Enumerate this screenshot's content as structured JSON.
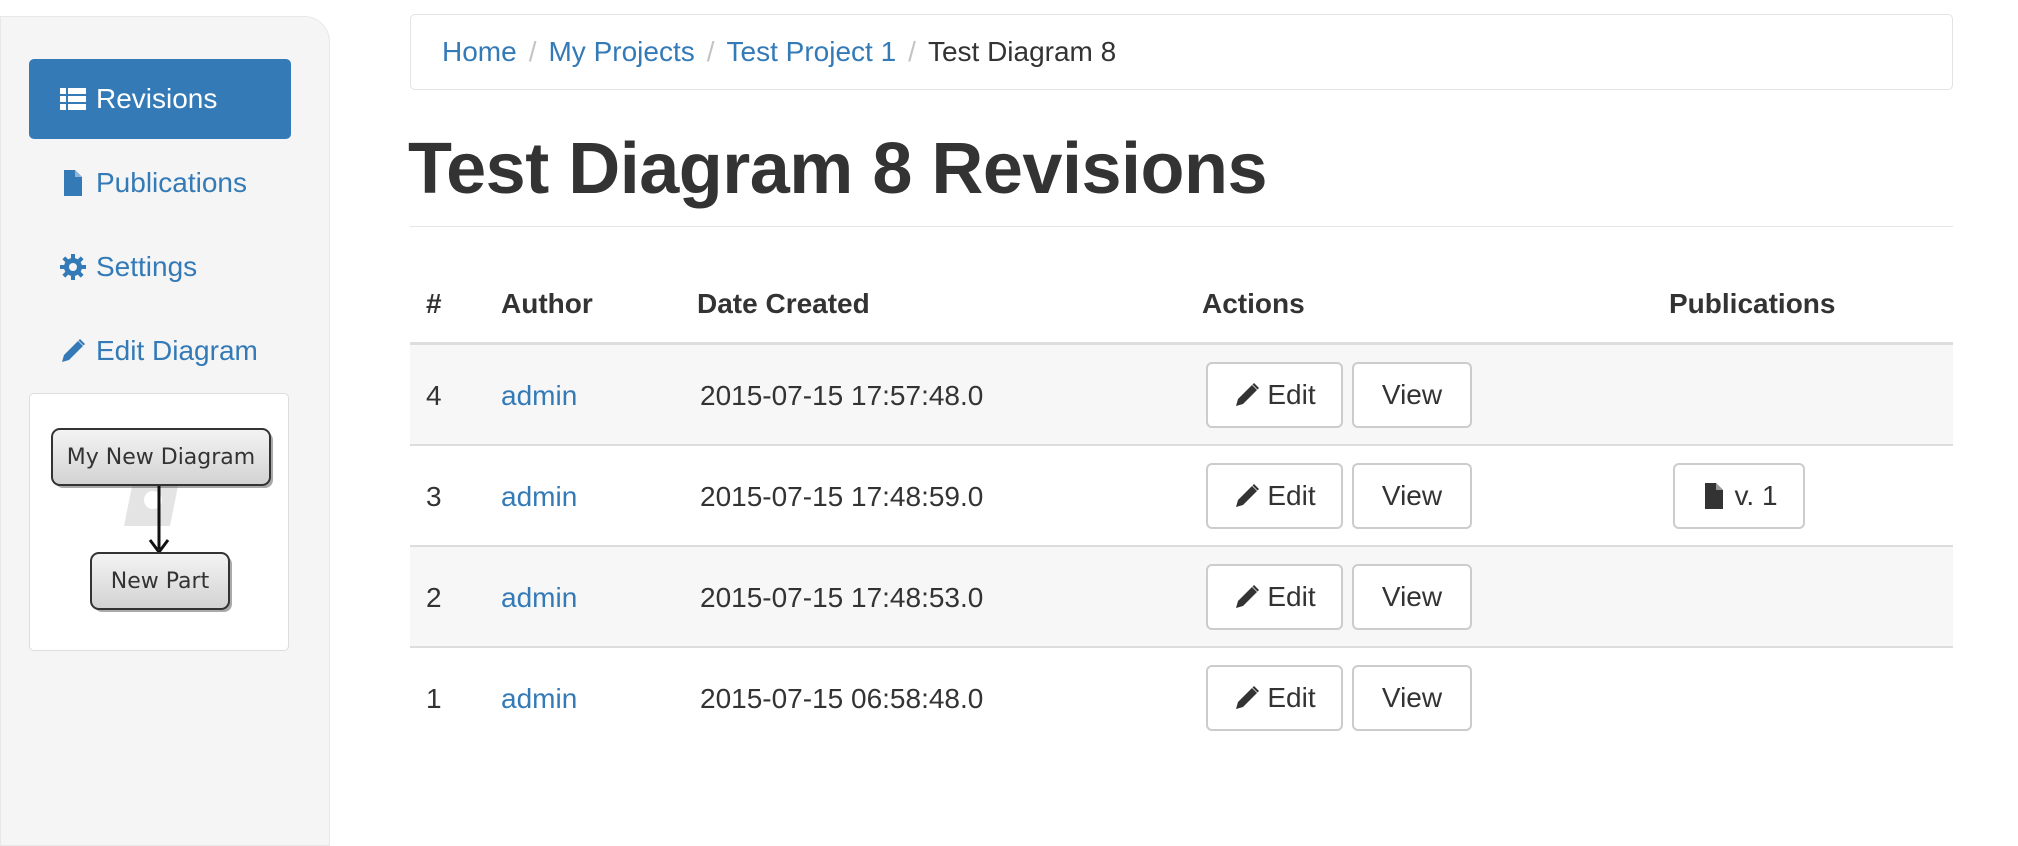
{
  "sidebar": {
    "items": [
      {
        "label": "Revisions",
        "icon": "list-icon",
        "active": true
      },
      {
        "label": "Publications",
        "icon": "file-icon",
        "active": false
      },
      {
        "label": "Settings",
        "icon": "gear-icon",
        "active": false
      },
      {
        "label": "Edit Diagram",
        "icon": "pencil-icon",
        "active": false
      }
    ],
    "thumbnail": {
      "node1": "My New Diagram",
      "node2": "New Part"
    }
  },
  "breadcrumb": {
    "items": [
      "Home",
      "My Projects",
      "Test Project 1"
    ],
    "current": "Test Diagram 8",
    "separator": "/"
  },
  "page": {
    "title": "Test Diagram 8 Revisions"
  },
  "table": {
    "headers": {
      "num": "#",
      "author": "Author",
      "date": "Date Created",
      "actions": "Actions",
      "publications": "Publications"
    },
    "edit_label": "Edit",
    "view_label": "View",
    "rows": [
      {
        "num": "4",
        "author": "admin",
        "date": "2015-07-15 17:57:48.0",
        "publication": ""
      },
      {
        "num": "3",
        "author": "admin",
        "date": "2015-07-15 17:48:59.0",
        "publication": "v. 1"
      },
      {
        "num": "2",
        "author": "admin",
        "date": "2015-07-15 17:48:53.0",
        "publication": ""
      },
      {
        "num": "1",
        "author": "admin",
        "date": "2015-07-15 06:58:48.0",
        "publication": ""
      }
    ]
  },
  "colors": {
    "accent": "#337ab7",
    "stripe": "#f7f7f7",
    "sidebar_bg": "#f5f5f5"
  }
}
